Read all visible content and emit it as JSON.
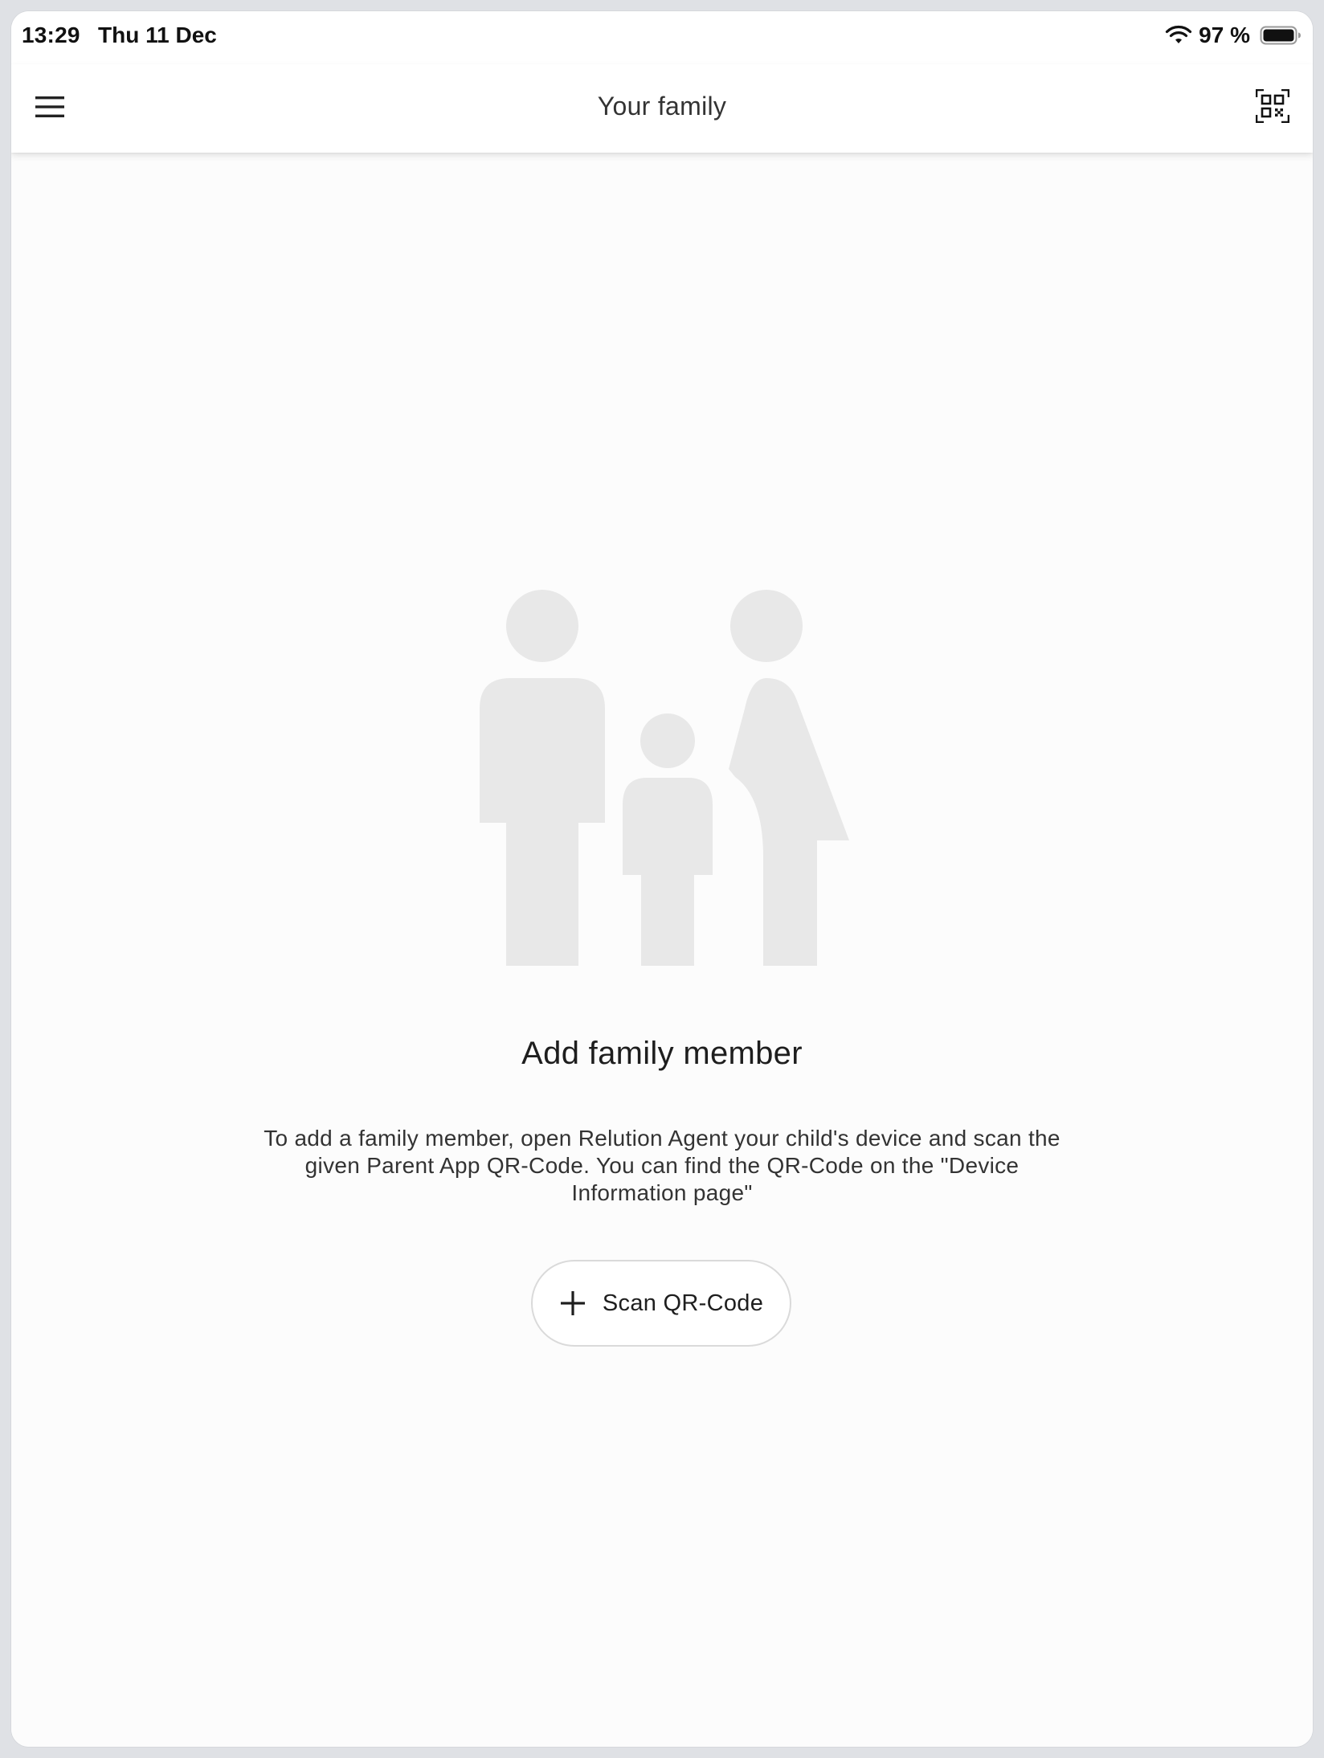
{
  "status_bar": {
    "time": "13:29",
    "date": "Thu 11 Dec",
    "battery_text": "97 %",
    "icons": [
      "wifi-icon",
      "battery-icon"
    ]
  },
  "app_bar": {
    "title": "Your family",
    "menu_icon": "hamburger-menu-icon",
    "action_icon": "qr-code-scan-icon"
  },
  "empty_state": {
    "illustration": "family-illustration",
    "heading": "Add family member",
    "description": "To add a family member, open Relution Agent your child's device and scan the given Parent App QR-Code. You can find the QR-Code on the \"Device Information page\"",
    "button": {
      "icon": "plus-icon",
      "label": "Scan QR-Code"
    }
  },
  "colors": {
    "background": "#fcfcfc",
    "app_bar": "#ffffff",
    "illustration": "#e8e8e8",
    "text_primary": "#1e1e1e",
    "button_border": "#dadada"
  }
}
